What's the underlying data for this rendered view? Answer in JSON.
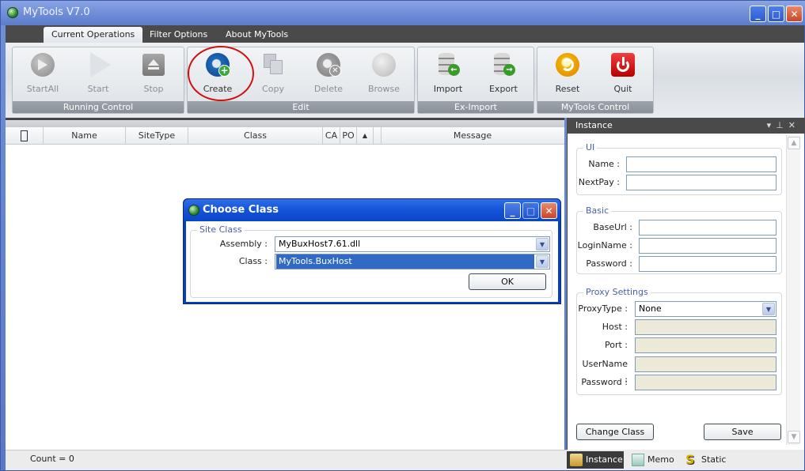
{
  "window": {
    "title": "MyTools V7.0",
    "controls": [
      "minimize",
      "maximize",
      "close"
    ]
  },
  "tabs": [
    {
      "label": "Current Operations",
      "active": true
    },
    {
      "label": "Filter Options",
      "active": false
    },
    {
      "label": "About MyTools",
      "active": false
    }
  ],
  "ribbon": {
    "groups": [
      {
        "label": "Running Control",
        "buttons": [
          {
            "label": "StartAll",
            "icon": "start-all-icon",
            "enabled": false
          },
          {
            "label": "Start",
            "icon": "play-icon",
            "enabled": false
          },
          {
            "label": "Stop",
            "icon": "eject-icon",
            "enabled": false
          }
        ]
      },
      {
        "label": "Edit",
        "buttons": [
          {
            "label": "Create",
            "icon": "create-disc-plus-icon",
            "enabled": true,
            "highlighted": true
          },
          {
            "label": "Copy",
            "icon": "copy-icon",
            "enabled": false
          },
          {
            "label": "Delete",
            "icon": "delete-icon",
            "enabled": false
          },
          {
            "label": "Browse",
            "icon": "browse-icon",
            "enabled": false
          }
        ]
      },
      {
        "label": "Ex-Import",
        "buttons": [
          {
            "label": "Import",
            "icon": "database-import-icon",
            "enabled": true
          },
          {
            "label": "Export",
            "icon": "database-export-icon",
            "enabled": true
          }
        ]
      },
      {
        "label": "MyTools Control",
        "buttons": [
          {
            "label": "Reset",
            "icon": "reset-icon",
            "enabled": true
          },
          {
            "label": "Quit",
            "icon": "power-icon",
            "enabled": true
          }
        ]
      }
    ]
  },
  "grid": {
    "columns": [
      "",
      "Name",
      "SiteType",
      "Class",
      "CA",
      "PO",
      "▲",
      "",
      "Message"
    ],
    "rows": []
  },
  "status": {
    "count_text": "Count = 0"
  },
  "instance_panel": {
    "title": "Instance",
    "sections": {
      "ui": {
        "legend": "UI",
        "fields": [
          {
            "label": "Name :",
            "value": ""
          },
          {
            "label": "NextPay :",
            "value": ""
          }
        ]
      },
      "basic": {
        "legend": "Basic",
        "fields": [
          {
            "label": "BaseUrl :",
            "value": ""
          },
          {
            "label": "LoginName :",
            "value": ""
          },
          {
            "label": "Password :",
            "value": ""
          }
        ]
      },
      "proxy": {
        "legend": "Proxy Settings",
        "proxy_type_label": "ProxyType :",
        "proxy_type_value": "None",
        "fields": [
          {
            "label": "Host :",
            "value": ""
          },
          {
            "label": "Port :",
            "value": ""
          },
          {
            "label": "UserName :",
            "value": ""
          },
          {
            "label": "Password :",
            "value": ""
          }
        ]
      }
    },
    "change_class_label": "Change Class",
    "save_label": "Save"
  },
  "bottom_tabs": [
    {
      "label": "Instance",
      "active": true
    },
    {
      "label": "Memo",
      "active": false
    },
    {
      "label": "Static",
      "active": false
    }
  ],
  "dialog": {
    "title": "Choose Class",
    "legend": "Site Class",
    "assembly_label": "Assembly :",
    "assembly_value": "MyBuxHost7.61.dll",
    "class_label": "Class :",
    "class_value": "MyTools.BuxHost",
    "ok_label": "OK"
  },
  "colors": {
    "titlebar": "#6c8ad6",
    "dark_bar": "#4a4a4a",
    "selection": "#316ac5",
    "dialog_title": "#1452d8",
    "highlight_circle": "#d01010"
  }
}
